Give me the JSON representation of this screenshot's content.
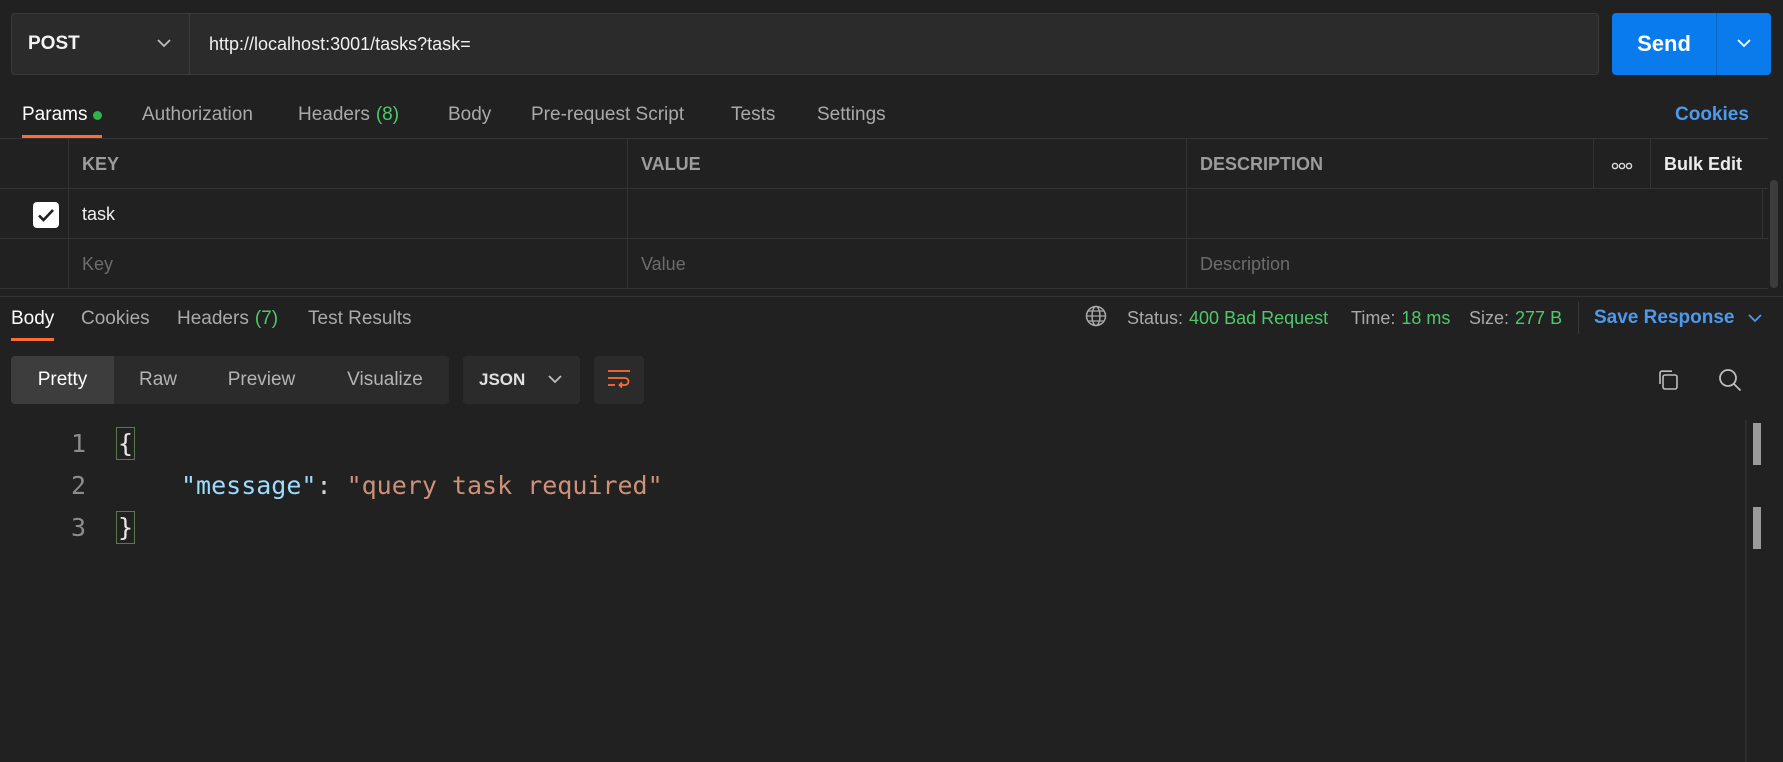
{
  "request": {
    "method": "POST",
    "url": "http://localhost:3001/tasks?task=",
    "send_label": "Send"
  },
  "request_tabs": {
    "params": "Params",
    "authorization": "Authorization",
    "headers": "Headers",
    "headers_count": "(8)",
    "body": "Body",
    "prerequest": "Pre-request Script",
    "tests": "Tests",
    "settings": "Settings",
    "cookies": "Cookies"
  },
  "params_table": {
    "col_key": "KEY",
    "col_value": "VALUE",
    "col_description": "DESCRIPTION",
    "more": "ooo",
    "bulk_edit": "Bulk Edit",
    "rows": [
      {
        "checked": true,
        "key": "task",
        "value": "",
        "description": ""
      }
    ],
    "placeholders": {
      "key": "Key",
      "value": "Value",
      "description": "Description"
    }
  },
  "response_tabs": {
    "body": "Body",
    "cookies": "Cookies",
    "headers": "Headers",
    "headers_count": "(7)",
    "test_results": "Test Results"
  },
  "status": {
    "status_label": "Status:",
    "status_value": "400 Bad Request",
    "time_label": "Time:",
    "time_value": "18 ms",
    "size_label": "Size:",
    "size_value": "277 B",
    "save_response": "Save Response"
  },
  "view_modes": [
    "Pretty",
    "Raw",
    "Preview",
    "Visualize"
  ],
  "format": "JSON",
  "code": {
    "line_numbers": [
      "1",
      "2",
      "3"
    ],
    "open_brace": "{",
    "key": "\"message\"",
    "colon": ": ",
    "value": "\"query task required\"",
    "close_brace": "}"
  },
  "colors": {
    "accent_orange": "#ff6c37",
    "send_blue": "#097bed",
    "success_green": "#4fc86b",
    "link_blue": "#4c9aee"
  },
  "icons": [
    "chevron-down-icon",
    "checkbox-checked-icon",
    "globe-icon",
    "wrap-lines-icon",
    "copy-icon",
    "search-icon"
  ]
}
